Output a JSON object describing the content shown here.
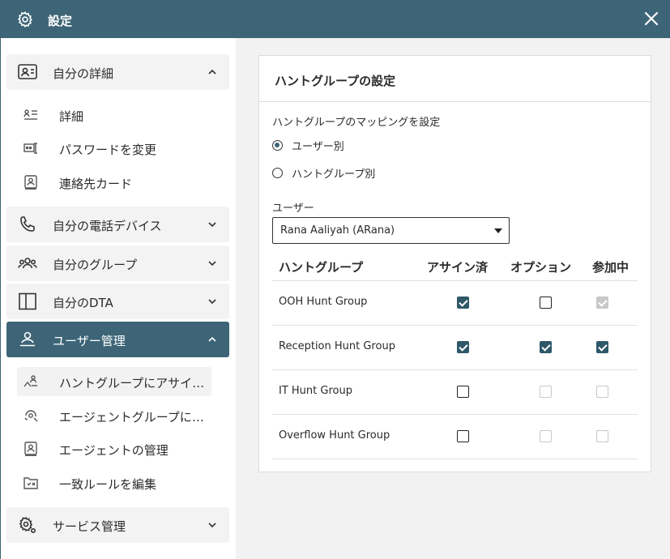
{
  "window": {
    "title": "設定"
  },
  "sidebar": {
    "sections": [
      {
        "label": "自分の詳細",
        "expanded": true,
        "icon": "contact-card-icon"
      },
      {
        "label": "自分の電話デバイス",
        "expanded": false,
        "icon": "phone-icon"
      },
      {
        "label": "自分のグループ",
        "expanded": false,
        "icon": "group-icon"
      },
      {
        "label": "自分のDTA",
        "expanded": false,
        "icon": "panel-icon"
      },
      {
        "label": "ユーザー管理",
        "expanded": true,
        "icon": "user-admin-icon"
      },
      {
        "label": "サービス管理",
        "expanded": false,
        "icon": "service-gear-icon"
      }
    ],
    "my_details_items": [
      {
        "label": "詳細"
      },
      {
        "label": "パスワードを変更"
      },
      {
        "label": "連絡先カード"
      }
    ],
    "user_admin_items": [
      {
        "label": "ハントグループにアサインする"
      },
      {
        "label": "エージェントグループにアサインする"
      },
      {
        "label": "エージェントの管理"
      },
      {
        "label": "一致ルールを編集"
      }
    ]
  },
  "main": {
    "card_title": "ハントグループの設定",
    "mapping_label": "ハントグループのマッピングを設定",
    "radio_options": [
      {
        "label": "ユーザー別",
        "selected": true
      },
      {
        "label": "ハントグループ別",
        "selected": false
      }
    ],
    "user_label": "ユーザー",
    "user_selected": "Rana Aaliyah (ARana)",
    "table": {
      "headers": [
        "ハントグループ",
        "アサイン済",
        "オプション",
        "参加中"
      ],
      "rows": [
        {
          "name": "OOH Hunt Group",
          "assigned": "checked",
          "optional": "unchecked",
          "joined": "disabled-checked"
        },
        {
          "name": "Reception Hunt Group",
          "assigned": "checked",
          "optional": "checked",
          "joined": "checked"
        },
        {
          "name": "IT Hunt Group",
          "assigned": "unchecked",
          "optional": "disabled",
          "joined": "disabled"
        },
        {
          "name": "Overflow Hunt Group",
          "assigned": "unchecked",
          "optional": "disabled",
          "joined": "disabled"
        }
      ]
    }
  },
  "colors": {
    "accent": "#3d6577",
    "checkbox": "#2f5869",
    "background": "#f2f2f2"
  }
}
